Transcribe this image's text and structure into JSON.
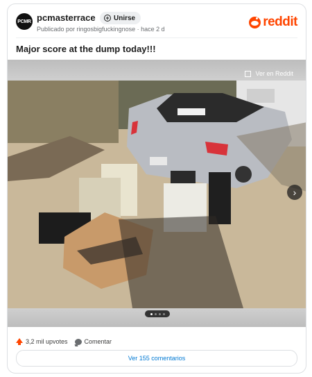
{
  "header": {
    "avatar_text": "PCMR",
    "subreddit": "pcmasterrace",
    "join_label": "Unirse",
    "meta": "Publicado por ringosbigfuckingnose · hace 2 d",
    "brand": "reddit"
  },
  "post": {
    "title": "Major score at the dump today!!!",
    "view_on_reddit": "Ver en Reddit",
    "upvotes": "3,2 mil upvotes",
    "comment_label": "Comentar",
    "view_comments": "Ver 155 comentarios"
  },
  "gallery": {
    "current": 1,
    "total": 4
  },
  "colors": {
    "brand": "#ff4500",
    "link": "#0079d3"
  }
}
